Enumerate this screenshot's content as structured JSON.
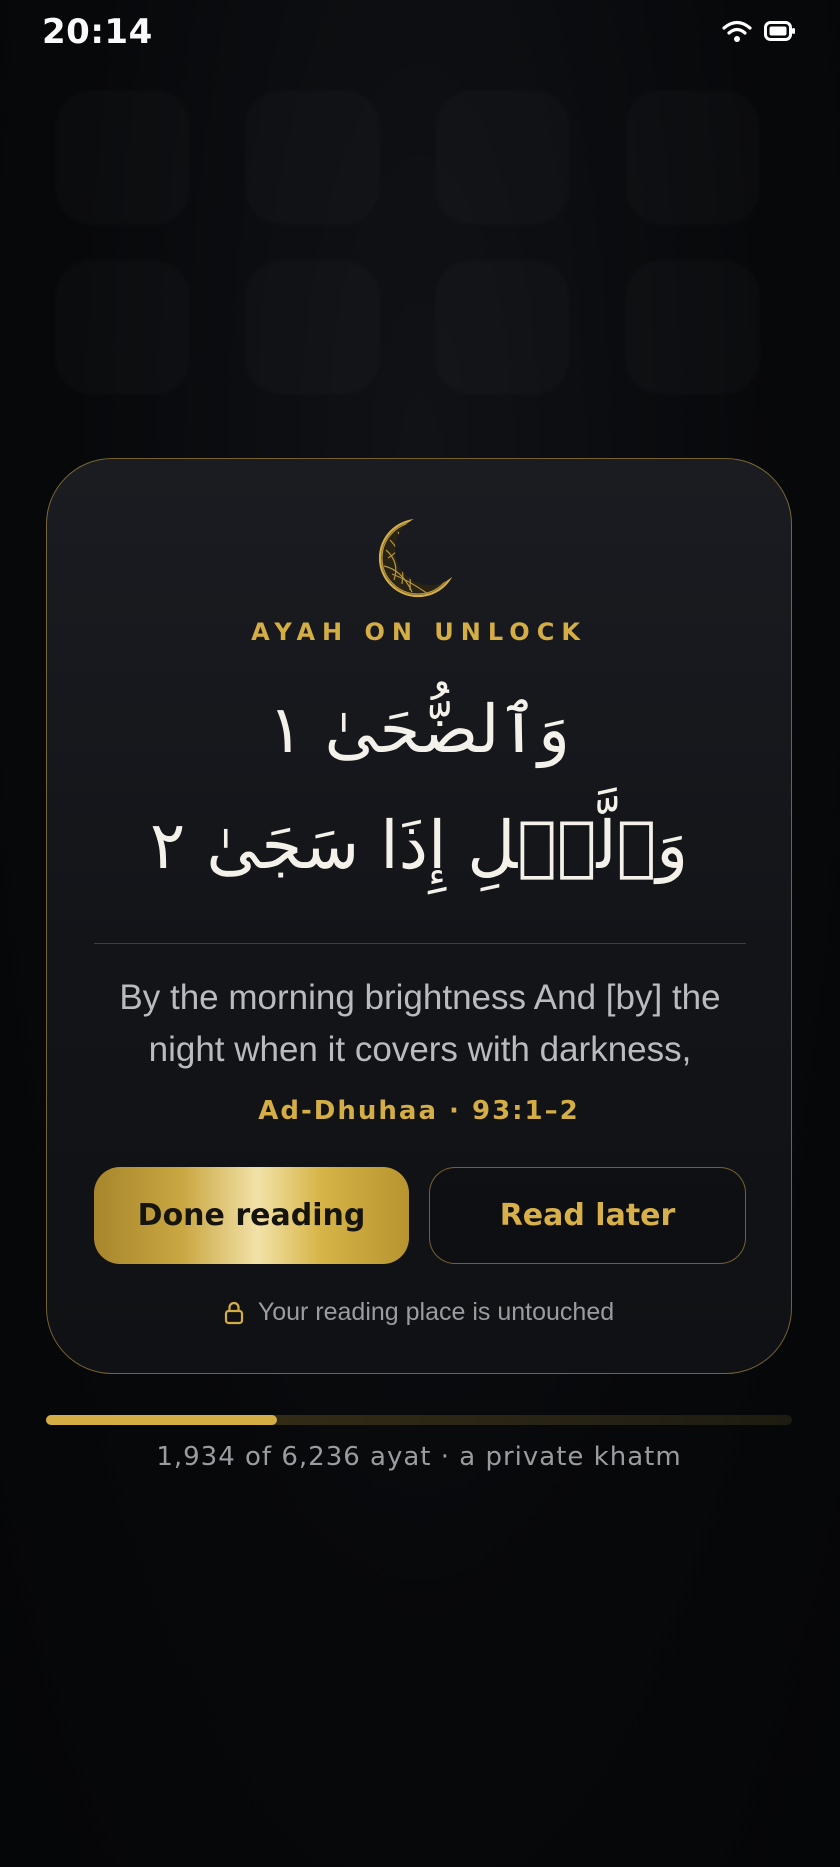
{
  "status_bar": {
    "time": "20:14",
    "wifi_icon": "wifi-icon",
    "battery_icon": "battery-icon"
  },
  "card": {
    "icon": "crescent-moon-icon",
    "eyebrow": "AYAH ON UNLOCK",
    "arabic_line_1": "وَٱلضُّحَىٰ ١",
    "arabic_line_2": "وَٱلَّيۡلِ إِذَا سَجَىٰ ٢",
    "translation": "By the morning brightness And [by] the night when it covers with darkness,",
    "reference": "Ad-Dhuhaa · 93:1–2",
    "done_button": "Done reading",
    "later_button": "Read later",
    "lock_icon": "lock-icon",
    "note": "Your reading place is untouched"
  },
  "progress": {
    "read": 1934,
    "total": 6236,
    "caption": "1,934 of 6,236 ayat · a private khatm"
  },
  "colors": {
    "accent": "#d4ad45",
    "background": "#07080a",
    "card": "#15171b"
  }
}
